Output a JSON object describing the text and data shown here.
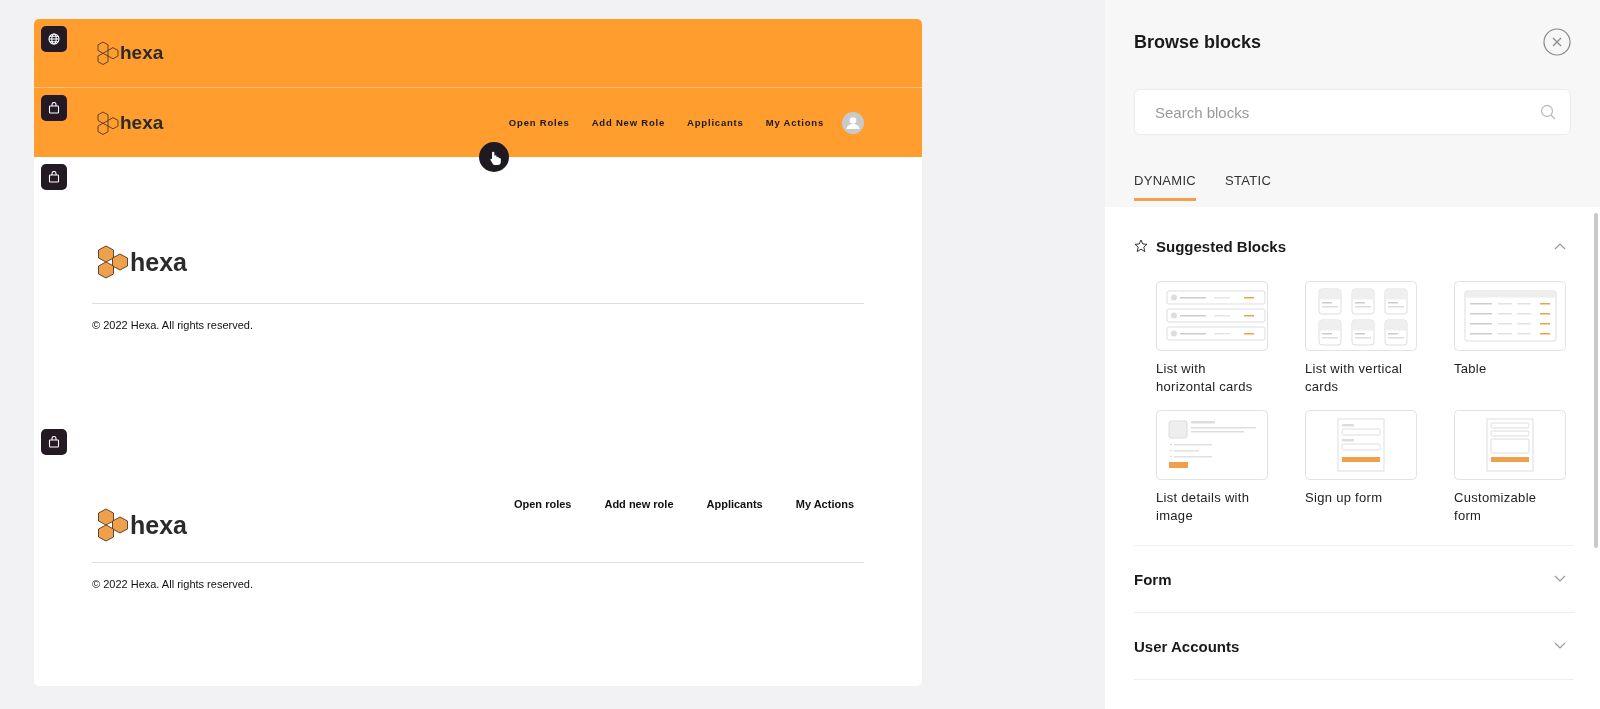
{
  "canvas": {
    "sections": [
      {
        "kind": "header",
        "logo": "hexa"
      },
      {
        "kind": "header",
        "logo": "hexa",
        "nav": [
          "Open Roles",
          "Add New Role",
          "Applicants",
          "My Actions"
        ]
      },
      {
        "kind": "footer",
        "logo": "hexa",
        "copyright": "© 2022 Hexa. All rights reserved."
      },
      {
        "kind": "footer",
        "logo": "hexa",
        "nav": [
          "Open roles",
          "Add new role",
          "Applicants",
          "My Actions"
        ],
        "copyright": "© 2022 Hexa. All rights reserved."
      }
    ]
  },
  "panel": {
    "title": "Browse blocks",
    "search": {
      "placeholder": "Search blocks"
    },
    "tabs": [
      {
        "label": "DYNAMIC",
        "selected": true
      },
      {
        "label": "STATIC",
        "selected": false
      }
    ],
    "groups": [
      {
        "title": "Suggested Blocks",
        "starred": true,
        "expanded": true,
        "blocks": [
          {
            "label": "List with horizontal cards",
            "kind": "hlist"
          },
          {
            "label": "List with vertical cards",
            "kind": "vcards"
          },
          {
            "label": "Table",
            "kind": "table"
          },
          {
            "label": "List details with image",
            "kind": "details"
          },
          {
            "label": "Sign up form",
            "kind": "signup"
          },
          {
            "label": "Customizable form",
            "kind": "custom"
          }
        ]
      },
      {
        "title": "Form",
        "starred": false,
        "expanded": false
      },
      {
        "title": "User Accounts",
        "starred": false,
        "expanded": false
      }
    ]
  }
}
